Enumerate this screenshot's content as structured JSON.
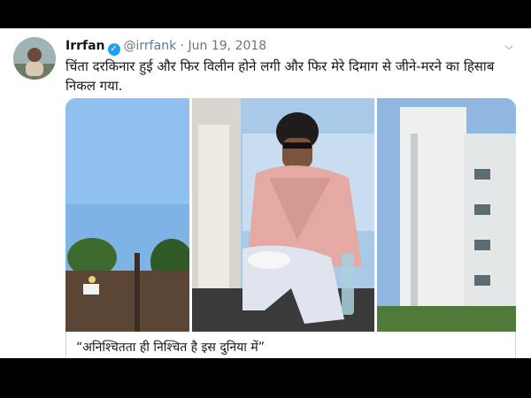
{
  "tweet": {
    "author_name": "Irrfan",
    "handle": "@irrfank",
    "separator": "·",
    "date": "Jun 19, 2018",
    "text": "चिंता दरकिनार हुई और फिर विलीन होने लगी और फिर मेरे दिमाग से जीने-मरने का हिसाब निकल गया.",
    "card_title": "“अनिश्चितता ही निश्चित है इस दुनिया में”"
  },
  "icons": {
    "verified": "verified-badge-icon",
    "more": "chevron-down-icon"
  },
  "colors": {
    "accent": "#1da1f2",
    "text": "#14171a",
    "muted": "#657786"
  }
}
